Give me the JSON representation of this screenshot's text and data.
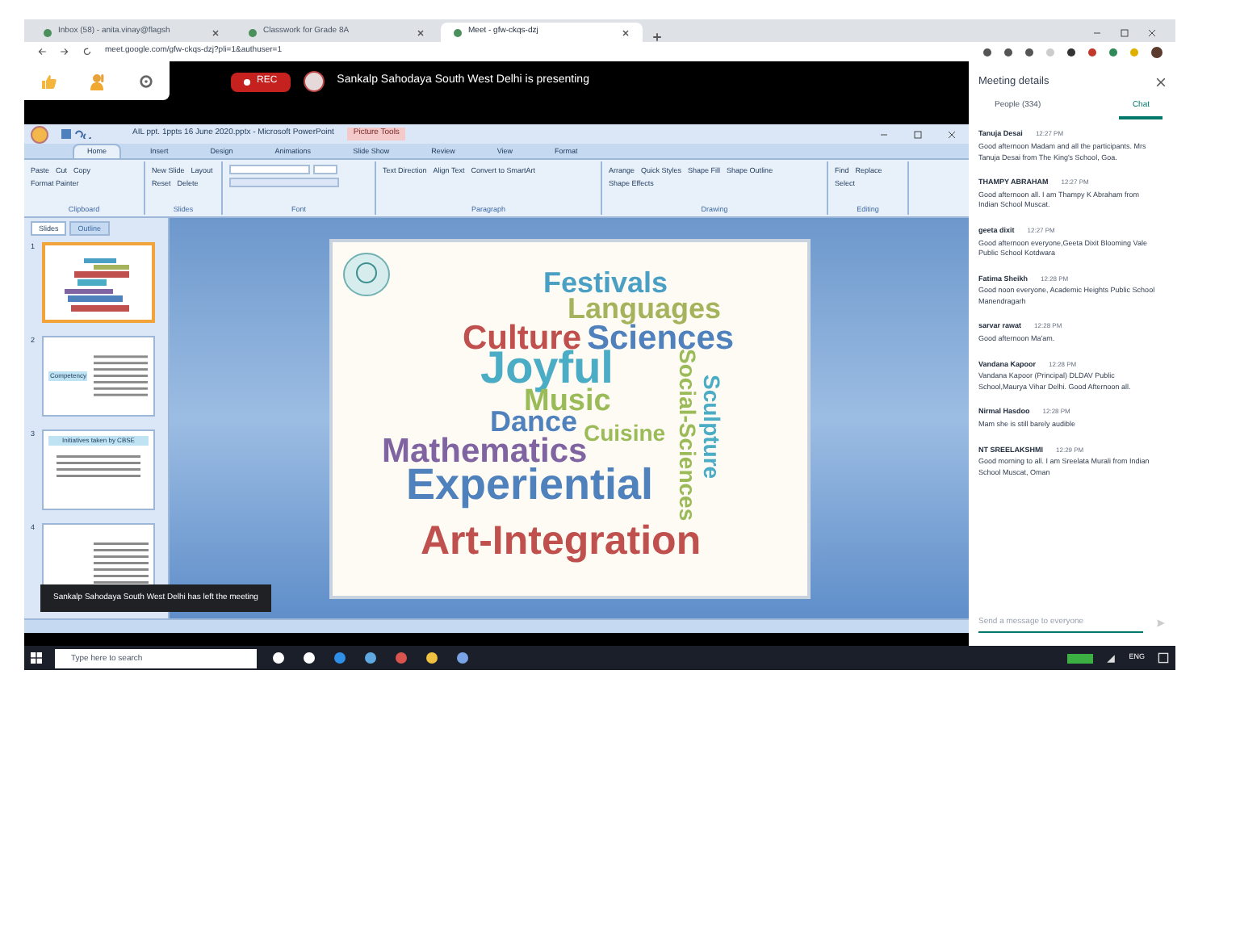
{
  "browser": {
    "tabs": [
      {
        "title": "Inbox (58) - anita.vinay@flagsh",
        "selected": false
      },
      {
        "title": "Classwork for Grade 8A",
        "selected": false
      },
      {
        "title": "Meet - gfw-ckqs-dzj",
        "selected": true
      }
    ],
    "url": "meet.google.com/gfw-ckqs-dzj?pli=1&authuser=1"
  },
  "meet_bar": {
    "rec_label": "REC",
    "presenter_message": "Sankalp Sahodaya South West Delhi is presenting"
  },
  "powerpoint": {
    "title": "AIL ppt. 1ppts 16 June 2020.pptx - Microsoft PowerPoint",
    "context_tab": "Picture Tools",
    "ribbon_tabs": [
      {
        "label": "Home",
        "selected": true
      },
      {
        "label": "Insert",
        "selected": false
      },
      {
        "label": "Design",
        "selected": false
      },
      {
        "label": "Animations",
        "selected": false
      },
      {
        "label": "Slide Show",
        "selected": false
      },
      {
        "label": "Review",
        "selected": false
      },
      {
        "label": "View",
        "selected": false
      },
      {
        "label": "Format",
        "selected": false
      }
    ],
    "ribbon_groups": [
      {
        "label": "Clipboard",
        "buttons": [
          "Paste",
          "Cut",
          "Copy",
          "Format Painter"
        ]
      },
      {
        "label": "Slides",
        "buttons": [
          "New Slide",
          "Layout",
          "Reset",
          "Delete"
        ]
      },
      {
        "label": "Font"
      },
      {
        "label": "Paragraph",
        "buttons": [
          "Text Direction",
          "Align Text",
          "Convert to SmartArt"
        ]
      },
      {
        "label": "Drawing",
        "buttons": [
          "Arrange",
          "Quick Styles",
          "Shape Fill",
          "Shape Outline",
          "Shape Effects"
        ]
      },
      {
        "label": "Editing",
        "buttons": [
          "Find",
          "Replace",
          "Select"
        ]
      }
    ],
    "pane_tabs": [
      {
        "label": "Slides",
        "selected": true
      },
      {
        "label": "Outline",
        "selected": false
      }
    ],
    "thumbnails": [
      {
        "number": "1",
        "kind": "wordcloud",
        "selected": true
      },
      {
        "number": "2",
        "kind": "text",
        "title": "Competency",
        "selected": false
      },
      {
        "number": "3",
        "kind": "title",
        "title": "Initiatives taken by CBSE",
        "selected": false
      },
      {
        "number": "4",
        "kind": "text",
        "selected": false
      }
    ],
    "slide": {
      "words": [
        {
          "text": "Festivals",
          "color": "#4a9fc4"
        },
        {
          "text": "Languages",
          "color": "#a5b45c"
        },
        {
          "text": "Culture",
          "color": "#c0504d"
        },
        {
          "text": "Sciences",
          "color": "#4f81bd"
        },
        {
          "text": "Joyful",
          "color": "#4bacc6"
        },
        {
          "text": "Music",
          "color": "#9bbb59"
        },
        {
          "text": "Dance",
          "color": "#4f81bd"
        },
        {
          "text": "Cuisine",
          "color": "#9bbb59"
        },
        {
          "text": "Mathematics",
          "color": "#8064a2"
        },
        {
          "text": "Experiential",
          "color": "#4f81bd"
        },
        {
          "text": "Art-Integration",
          "color": "#c0504d"
        },
        {
          "text": "Social-Sciences",
          "color": "#9bbb59"
        },
        {
          "text": "Sculpture",
          "color": "#4bacc6"
        }
      ]
    },
    "toast": "Sankalp Sahodaya South West Delhi has left the meeting"
  },
  "panel": {
    "title": "Meeting details",
    "tabs": [
      {
        "label": "People (334)",
        "selected": false
      },
      {
        "label": "Chat",
        "selected": true
      }
    ],
    "messages": [
      {
        "sender": "Tanuja Desai",
        "time": "12:27 PM",
        "text": "Good afternoon Madam and all the participants. Mrs Tanuja Desai from The King's School, Goa."
      },
      {
        "sender": "THAMPY ABRAHAM",
        "time": "12:27 PM",
        "text": "Good afternoon all. I am Thampy K Abraham from Indian School Muscat."
      },
      {
        "sender": "geeta dixit",
        "time": "12:27 PM",
        "text": "Good afternoon everyone,Geeta Dixit Blooming Vale Public School Kotdwara"
      },
      {
        "sender": "Fatima Sheikh",
        "time": "12:28 PM",
        "text": "Good noon everyone, Academic Heights Public School Manendragarh"
      },
      {
        "sender": "sarvar rawat",
        "time": "12:28 PM",
        "text": "Good afternoon Ma'am."
      },
      {
        "sender": "Vandana Kapoor",
        "time": "12:28 PM",
        "text": "Vandana Kapoor (Principal) DLDAV Public School,Maurya Vihar Delhi. Good Afternoon all."
      },
      {
        "sender": "Nirmal Hasdoo",
        "time": "12:28 PM",
        "text": "Mam she is still barely audible"
      },
      {
        "sender": "NT SREELAKSHMI",
        "time": "12:29 PM",
        "text": "Good morning to all. I am Sreelata Murali from Indian School Muscat, Oman"
      }
    ],
    "input_placeholder": "Send a message to everyone"
  },
  "taskbar": {
    "search_placeholder": "Type here to search",
    "language": "ENG"
  }
}
